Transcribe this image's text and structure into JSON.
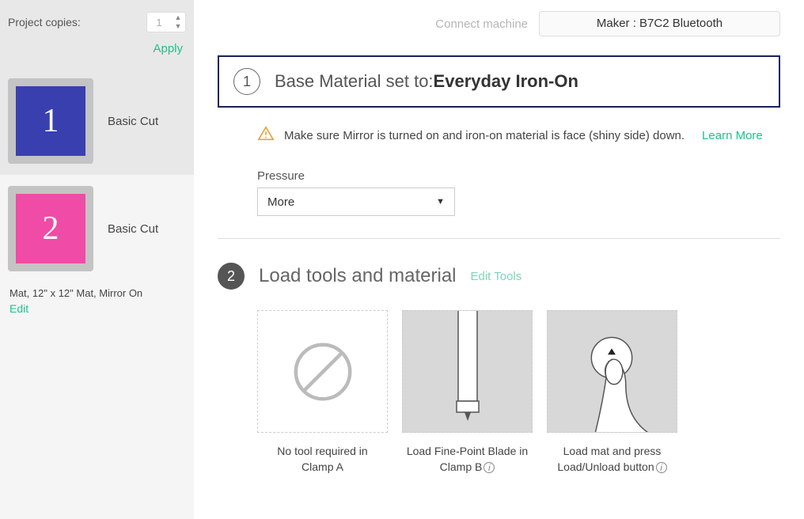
{
  "sidebar": {
    "copies_label": "Project copies:",
    "copies_value": "1",
    "apply_label": "Apply",
    "mats": [
      {
        "num": "1",
        "label": "Basic Cut",
        "color": "blue"
      },
      {
        "num": "2",
        "label": "Basic Cut",
        "color": "pink"
      }
    ],
    "mat_info": "Mat, 12\" x 12\" Mat, Mirror On",
    "edit_label": "Edit"
  },
  "topbar": {
    "connect_label": "Connect machine",
    "machine": "Maker : B7C2 Bluetooth"
  },
  "step1": {
    "num": "1",
    "title_prefix": "Base Material set to:",
    "title_value": "Everyday Iron-On",
    "warning": "Make sure Mirror is turned on and iron-on material is face (shiny side) down.",
    "learn_more": "Learn More",
    "pressure_label": "Pressure",
    "pressure_value": "More"
  },
  "step2": {
    "num": "2",
    "title": "Load tools and material",
    "edit_tools": "Edit Tools",
    "tools": [
      {
        "caption_line1": "No tool required in",
        "caption_line2": "Clamp A",
        "info": false
      },
      {
        "caption_line1": "Load Fine-Point Blade in",
        "caption_line2": "Clamp B",
        "info": true
      },
      {
        "caption_line1": "Load mat and press",
        "caption_line2": "Load/Unload button",
        "info": true
      }
    ]
  }
}
